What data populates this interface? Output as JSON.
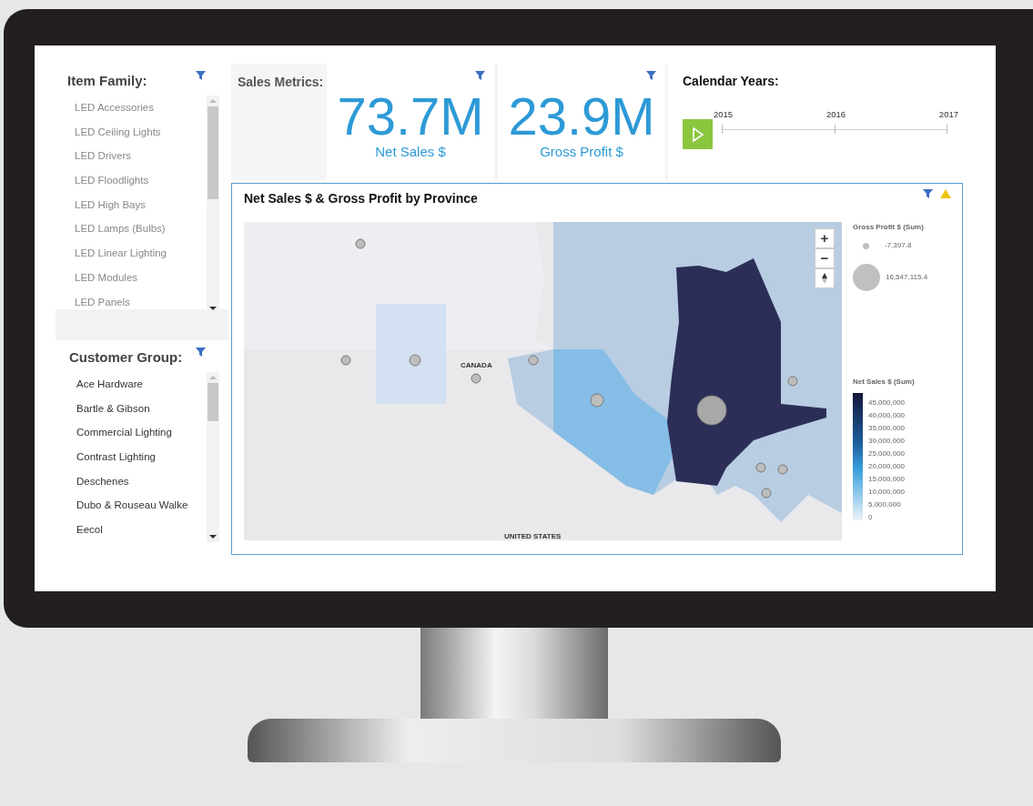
{
  "item_family": {
    "title": "Item Family:",
    "items": [
      "LED Accessories",
      "LED Ceiling Lights",
      "LED Drivers",
      "LED Floodlights",
      "LED High Bays",
      "LED Lamps (Bulbs)",
      "LED Linear Lighting",
      "LED Modules",
      "LED Panels"
    ]
  },
  "customer_group": {
    "title": "Customer Group:",
    "items": [
      "Ace Hardware",
      "Bartle & Gibson",
      "Commercial Lighting",
      "Contrast Lighting",
      "Deschenes",
      "Dubo & Rouseau Walke",
      "Eecol"
    ]
  },
  "sales_metrics": {
    "title": "Sales Metrics:",
    "kpis": [
      {
        "value": "73.7M",
        "label": "Net Sales $"
      },
      {
        "value": "23.9M",
        "label": "Gross Profit $"
      }
    ]
  },
  "calendar": {
    "title": "Calendar Years:",
    "years": [
      "2015",
      "2016",
      "2017"
    ]
  },
  "map_panel": {
    "title": "Net Sales $ & Gross Profit by Province",
    "map_labels": [
      "CANADA",
      "UNITED STATES"
    ],
    "zoom_controls": [
      "+",
      "−"
    ],
    "size_legend": {
      "title": "Gross Profit $ (Sum)",
      "entries": [
        "-7,397.8",
        "16,547,115.4"
      ]
    },
    "color_legend": {
      "title": "Net Sales $ (Sum)",
      "ticks": [
        "45,000,000",
        "40,000,000",
        "35,000,000",
        "30,000,000",
        "25,000,000",
        "20,000,000",
        "15,000,000",
        "10,000,000",
        "5,000,000",
        "0"
      ]
    }
  }
}
